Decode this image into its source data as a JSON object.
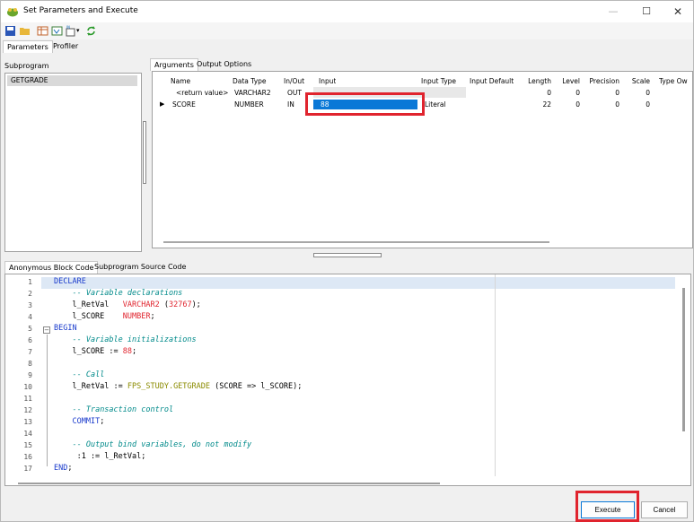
{
  "window": {
    "title": "Set Parameters and Execute"
  },
  "main_tabs": [
    "Parameters",
    "Profiler"
  ],
  "subprogram": {
    "label": "Subprogram",
    "items": [
      "GETGRADE"
    ]
  },
  "arg_tabs": [
    "Arguments",
    "Output Options"
  ],
  "grid": {
    "headers": [
      "Name",
      "Data Type",
      "In/Out",
      "Input",
      "Input Type",
      "Input Default",
      "Length",
      "Level",
      "Precision",
      "Scale",
      "Type Ow"
    ],
    "rows": [
      [
        "<return value>",
        "VARCHAR2",
        "OUT",
        "",
        "",
        "",
        "0",
        "0",
        "0",
        "0",
        ""
      ],
      [
        "SCORE",
        "NUMBER",
        "IN",
        "88",
        "Literal",
        "",
        "22",
        "0",
        "0",
        "0",
        ""
      ]
    ]
  },
  "code_tabs": [
    "Anonymous Block Code",
    "Subprogram Source Code"
  ],
  "code": {
    "line_numbers": [
      "1",
      "2",
      "3",
      "4",
      "5",
      "6",
      "7",
      "8",
      "9",
      "10",
      "11",
      "12",
      "13",
      "14",
      "15",
      "16",
      "17"
    ]
  },
  "buttons": {
    "execute": "Execute",
    "cancel": "Cancel"
  },
  "colors": {
    "accent": "#0a78d7",
    "highlight": "#e0242e"
  }
}
